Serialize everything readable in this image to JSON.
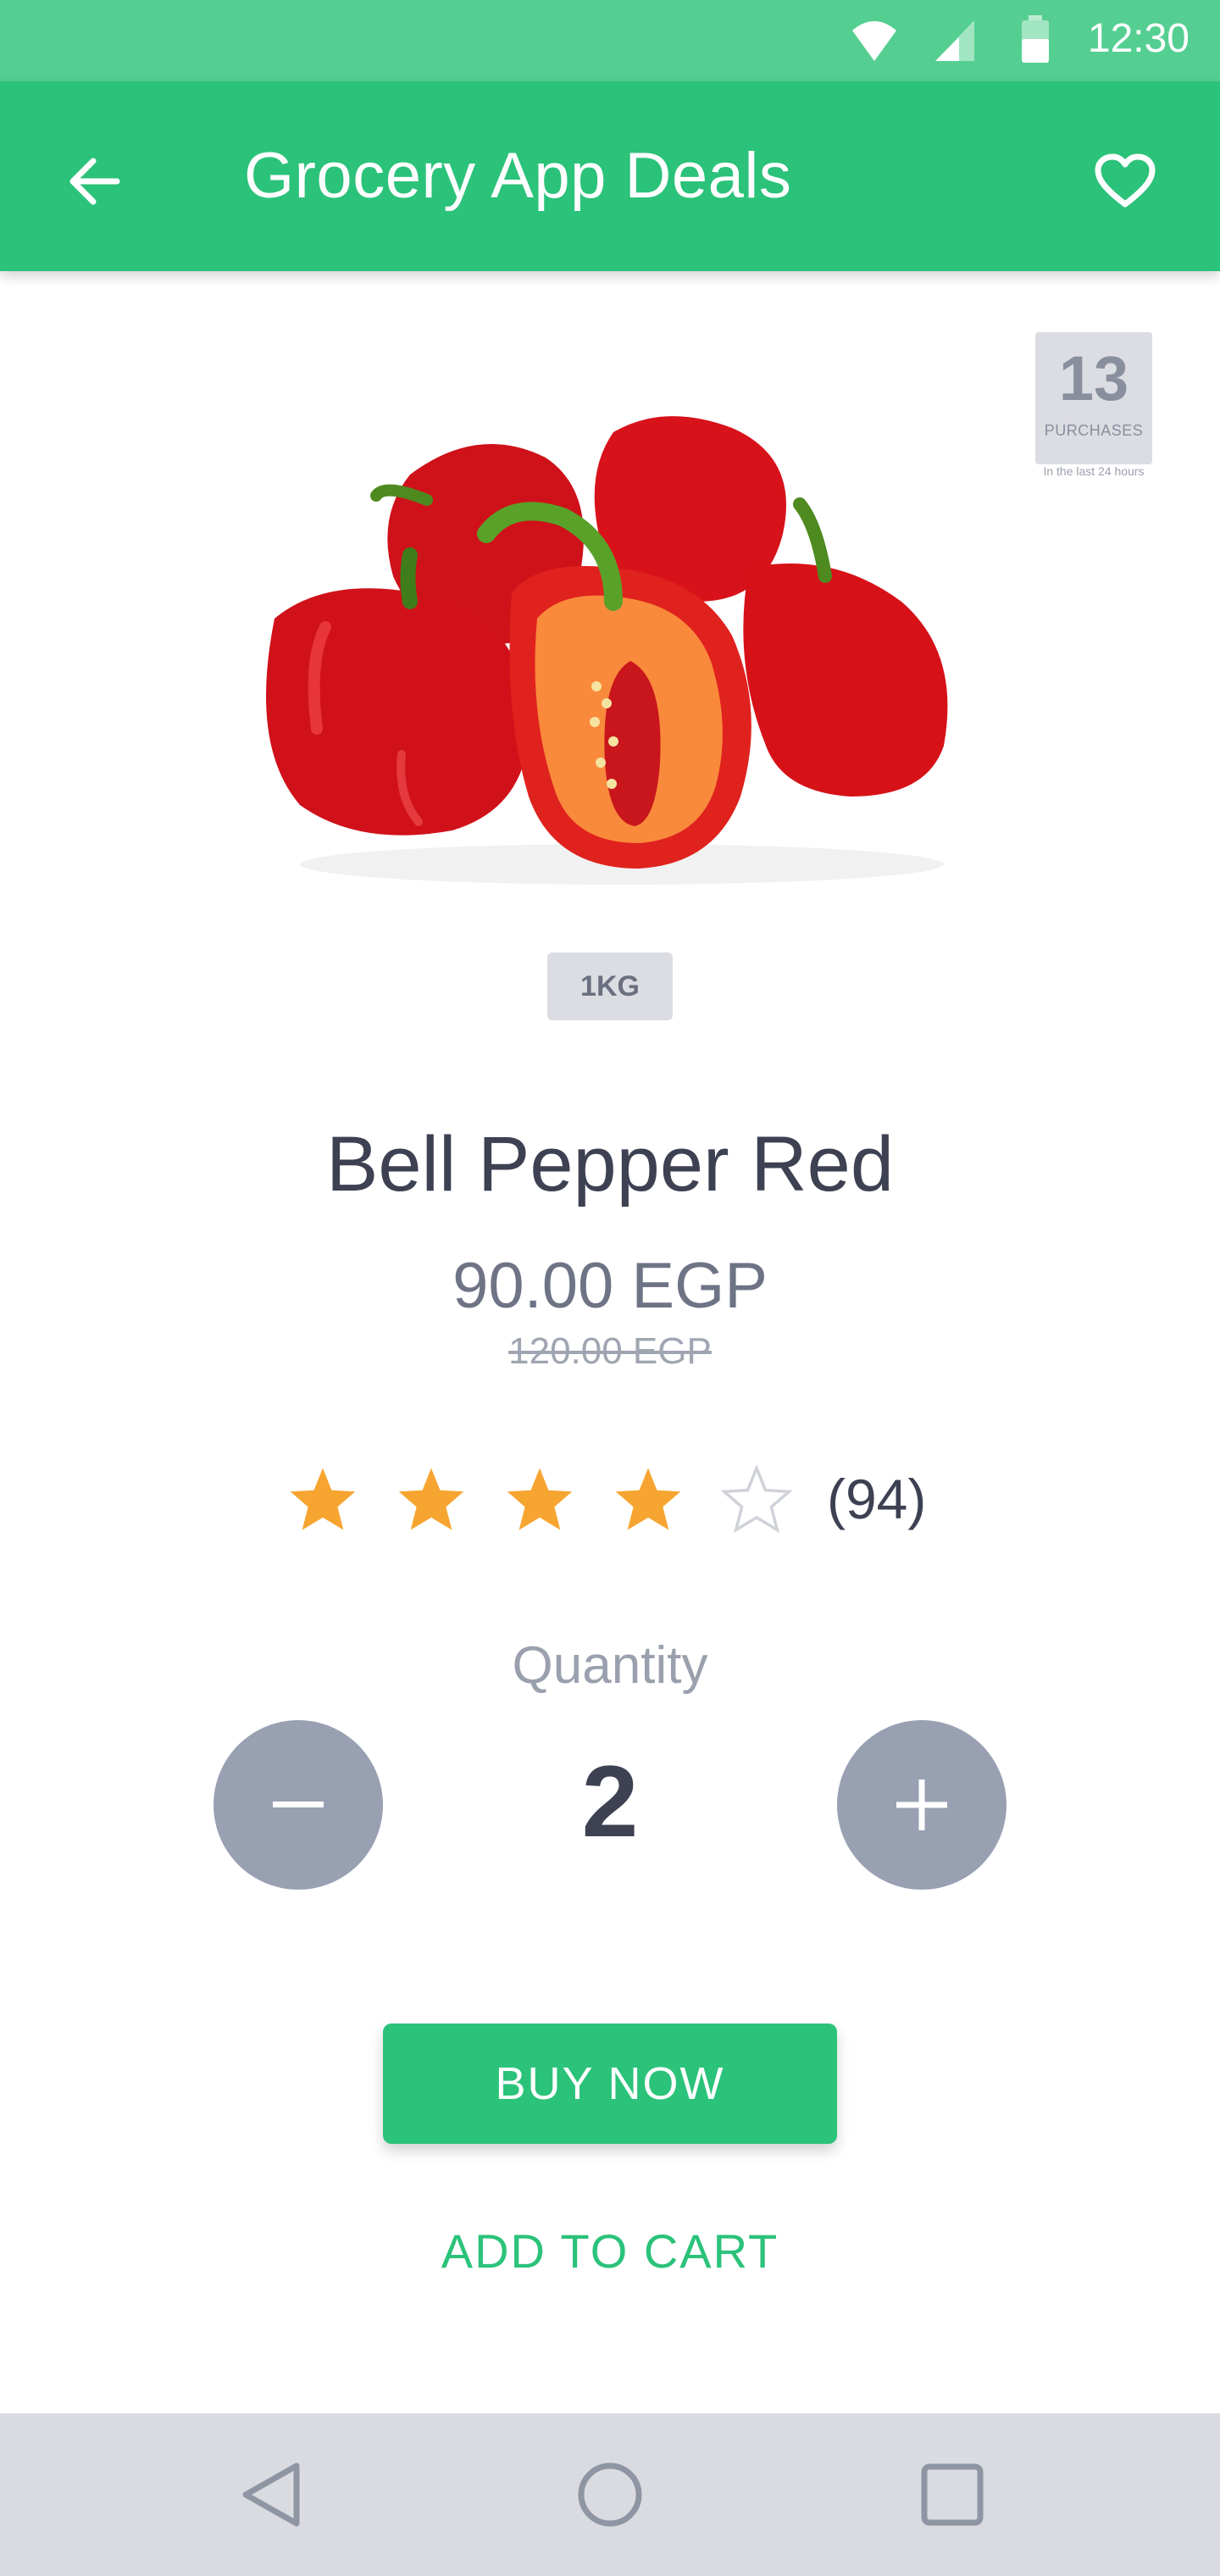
{
  "status_bar": {
    "time": "12:30",
    "icons": [
      "wifi-icon",
      "signal-icon",
      "battery-icon"
    ],
    "color": "#55cf91"
  },
  "app_bar": {
    "title": "Grocery App Deals",
    "back_icon": "arrow-left-icon",
    "favorite_icon": "heart-outline-icon",
    "color": "#2bc27a"
  },
  "purchases_badge": {
    "count": "13",
    "label": "PURCHASES",
    "note": "In the last 24 hours"
  },
  "product": {
    "image": "red-bell-peppers",
    "weight": "1KG",
    "name": "Bell Pepper Red",
    "price": "90.00 EGP",
    "old_price": "120.00 EGP",
    "rating": {
      "value": 4,
      "max": 5,
      "reviews": "(94)",
      "star_color": "#f7a531"
    }
  },
  "quantity": {
    "label": "Quantity",
    "value": "2",
    "decrement_icon": "minus-icon",
    "increment_icon": "plus-icon"
  },
  "actions": {
    "buy_now": "BUY NOW",
    "add_to_cart": "ADD TO CART"
  },
  "nav_bar": {
    "icons": [
      "back-triangle-icon",
      "home-circle-icon",
      "recents-square-icon"
    ]
  }
}
